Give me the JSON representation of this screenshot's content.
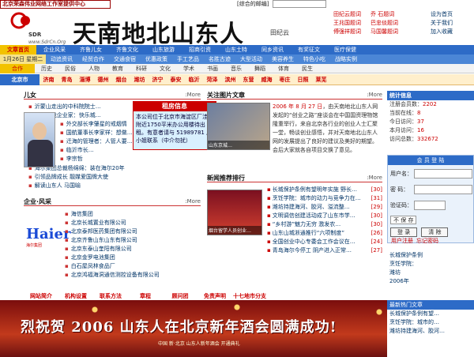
{
  "top_badge": "北京荣森伟业网络工作室提供中心",
  "search": {
    "label": "[综合的邮编]",
    "placeholder": ""
  },
  "logo": {
    "mark": "SDR",
    "domain": "www.SdrCn.Org"
  },
  "calligraphy": "天南地北山东人",
  "calligraphy_sign": "田纪云",
  "header_links": [
    [
      "田纪云题词",
      "乔 石题词"
    ],
    [
      "王兆国题词",
      "巴忠倓题词"
    ],
    [
      "傅强祥题词",
      "马国馨题词"
    ]
  ],
  "right_top_links": [
    "设为首页",
    "关于我们",
    "加入收藏"
  ],
  "nav1": [
    "文章首页",
    "企业风采",
    "齐鲁儿女",
    "齐鲁文化",
    "山东旅游",
    "招商引资",
    "山东土特",
    "同乡资讯",
    "有奖征文",
    "医疗保健"
  ],
  "nav2_date": "1月26日 星期二",
  "nav2": [
    "动追资讯",
    "经贸合作",
    "交通食宿",
    "优惠政策",
    "手工艺品",
    "名胜古迹",
    "大型活动",
    "美容养生",
    "特色小吃",
    "战略实例"
  ],
  "nav3_highlight": "合作",
  "nav3": [
    "历史",
    "民俗",
    "人物",
    "教育",
    "科研",
    "文化",
    "学术",
    "书画",
    "音乐",
    "舞蹈",
    "体育",
    "民生"
  ],
  "nav4_city": "北京市",
  "nav4": [
    "济南",
    "青岛",
    "淄博",
    "德州",
    "烟台",
    "潍坊",
    "济宁",
    "泰安",
    "临沂",
    "菏泽",
    "滨州",
    "东营",
    "威海",
    "枣庄",
    "日照",
    "莱芜"
  ],
  "section_people": {
    "title": "儿女",
    "more": ":More"
  },
  "people_list": [
    "沂蒙山走出的中科院院士…",
    "青岛总裁企业家：快乐城…",
    "外交部长李肇星的戒烟情",
    "国航董事长李家祥：想做…",
    "迁海的管理者：人管人要…",
    "临沂市长…",
    "李宗哲",
    "海尔集团总裁杨绵绵：装在海尔20年",
    "引领品牌成长 靓媒爱国牌大使",
    "解读山东人 马国喻"
  ],
  "popup": {
    "title": "租房信息",
    "body": "本公司位于北京市海淀区厂洼街附近1750平米办公用楼待出租。有意者请与 51989781 周小姐联系（中介勿扰）"
  },
  "section_pics": {
    "title": "关注图片文章",
    "more": ":More"
  },
  "pic_caption": "山东京城…",
  "pic_text_date": "2006 年 8 月 27 日",
  "pic_text": "，由天南地北山东人网发起的“创业之路”座谈会在中国国资理物馆隆重举行，来自北京各行业的创业人士汇聚一堂，畅谈创业感悟，并对天南地北山东人网的发展提出了良好的建议及美好的期望。会后大家就各自项目交换了意见。",
  "section_ranks": {
    "title": "新闻推荐排行",
    "more": ":More"
  },
  "rank_caption": "烟台留学人员创业…",
  "ranks": [
    [
      "长城保护条例有望明年实施 野长…",
      "30"
    ],
    [
      "烹饪学院：城市的动力与竞争力在…",
      "31"
    ],
    [
      "潍坊持建海河、胶河、溢流整…",
      "29"
    ],
    [
      "文明调信创建活动成了山东市学…",
      "30"
    ],
    [
      "“乡村游”魅力无穷 激发农…",
      "30"
    ],
    [
      "山东山城淅通推行“六项制度”",
      "26"
    ],
    [
      "全国创业中心专委会工作会议在…",
      "24"
    ],
    [
      "青岛海尔今停工 阴产进入正常…",
      "27"
    ]
  ],
  "section_biz": {
    "title": "企业·风采",
    "more": ":More"
  },
  "haier": {
    "brand": "Haier",
    "sub": "海尔集团"
  },
  "biz_list": [
    "海信集团",
    "北京长城置业有限公司",
    "北京泰邦医药集团有限公司",
    "北京齐鲁山东山东有限公司",
    "北京东泰山奎阳有限公司",
    "北京金罗电池集团",
    "白石屋凤林食品厂",
    "北京鸿福海洞通信测控设备有限公司"
  ],
  "footer_links": [
    "网站简介",
    "机构设置",
    "联系方法",
    "章程",
    "顾问团",
    "免责声明",
    "十七地市分支"
  ],
  "stats": {
    "header": "统计信息",
    "rows": [
      [
        "注册会员数：",
        "2202"
      ],
      [
        "当前在线：",
        "8"
      ],
      [
        "今日访问：",
        "37"
      ],
      [
        "本月访问：",
        "16"
      ],
      [
        "访问总数：",
        "332672"
      ]
    ]
  },
  "login": {
    "header": "会 员 登 陆",
    "user_label": "用户名：",
    "pass_label": "密 码：",
    "code_label": "验证码：",
    "remember": "不 保 存",
    "login_btn": "登 录",
    "clear_btn": "清 除",
    "register": "用户注册",
    "forgot": "忘记密码"
  },
  "side_links": [
    "长城保护条例",
    "烹饪学院：",
    "潍坊",
    "2006年"
  ],
  "banner": {
    "text": "烈祝贺 2006 山东人在北京新年酒会圆满成功!",
    "sub": "中国 新·北京 山东人新年酒会 开通典礼"
  },
  "recent": {
    "header": "最新热门文章",
    "items": [
      "长城保护条例有望…",
      "烹饪学院：城市的…",
      "潍坊持建海河、胶河…"
    ]
  }
}
